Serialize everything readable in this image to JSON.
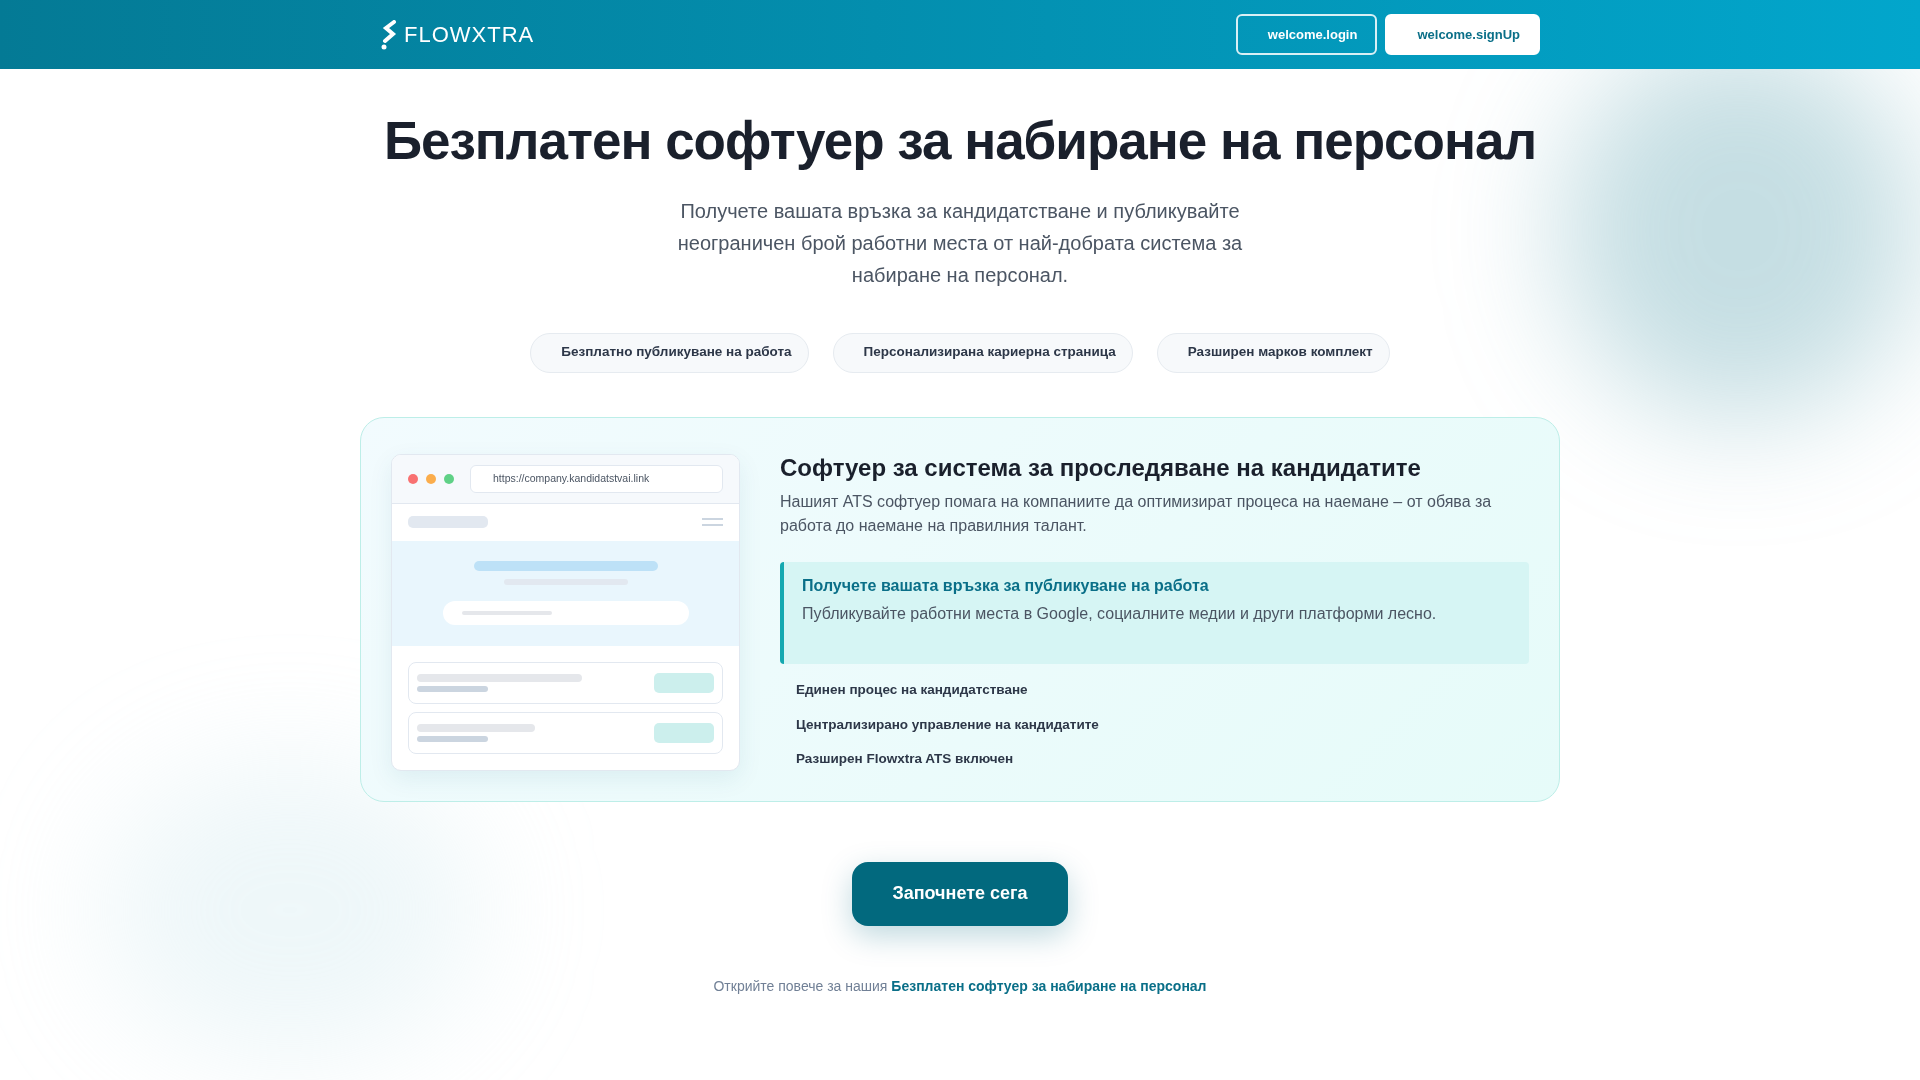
{
  "header": {
    "logo_text": "FLOWXTRA",
    "buttons": [
      {
        "label": "welcome.login",
        "kind": "outline"
      },
      {
        "label": "welcome.signUp",
        "kind": "solid"
      }
    ]
  },
  "hero": {
    "title": "Безплатен софтуер за набиране на персонал",
    "subtitle": "Получете вашата връзка за кандидатстване и публикувайте неограничен брой работни места от най-добрата система за набиране на персонал.",
    "pills": [
      "Безплатно публикуване на работа",
      "Персонализирана кариерна страница",
      "Разширен марков комплект"
    ]
  },
  "feature_card": {
    "mockup_url": "https://company.kandidatstvai.link",
    "heading": "Софтуер за система за проследяване на кандидатите",
    "description": "Нашият ATS софтуер помага на компаниите да оптимизират процеса на наемане – от обява за работа до наемане на правилния талант.",
    "highlight": {
      "title": "Получете вашата връзка за публикуване на работа",
      "text": "Публикувайте работни места в Google, социалните медии и други платформи лесно."
    },
    "items": [
      "Единен процес на кандидатстване",
      "Централизирано управление на кандидатите",
      "Разширен Flowxtra ATS включен"
    ]
  },
  "cta": {
    "label": "Започнете сега"
  },
  "footer_note": {
    "prefix": "Открийте повече за нашия",
    "link": "Безплатен софтуер за набиране на персонал"
  }
}
